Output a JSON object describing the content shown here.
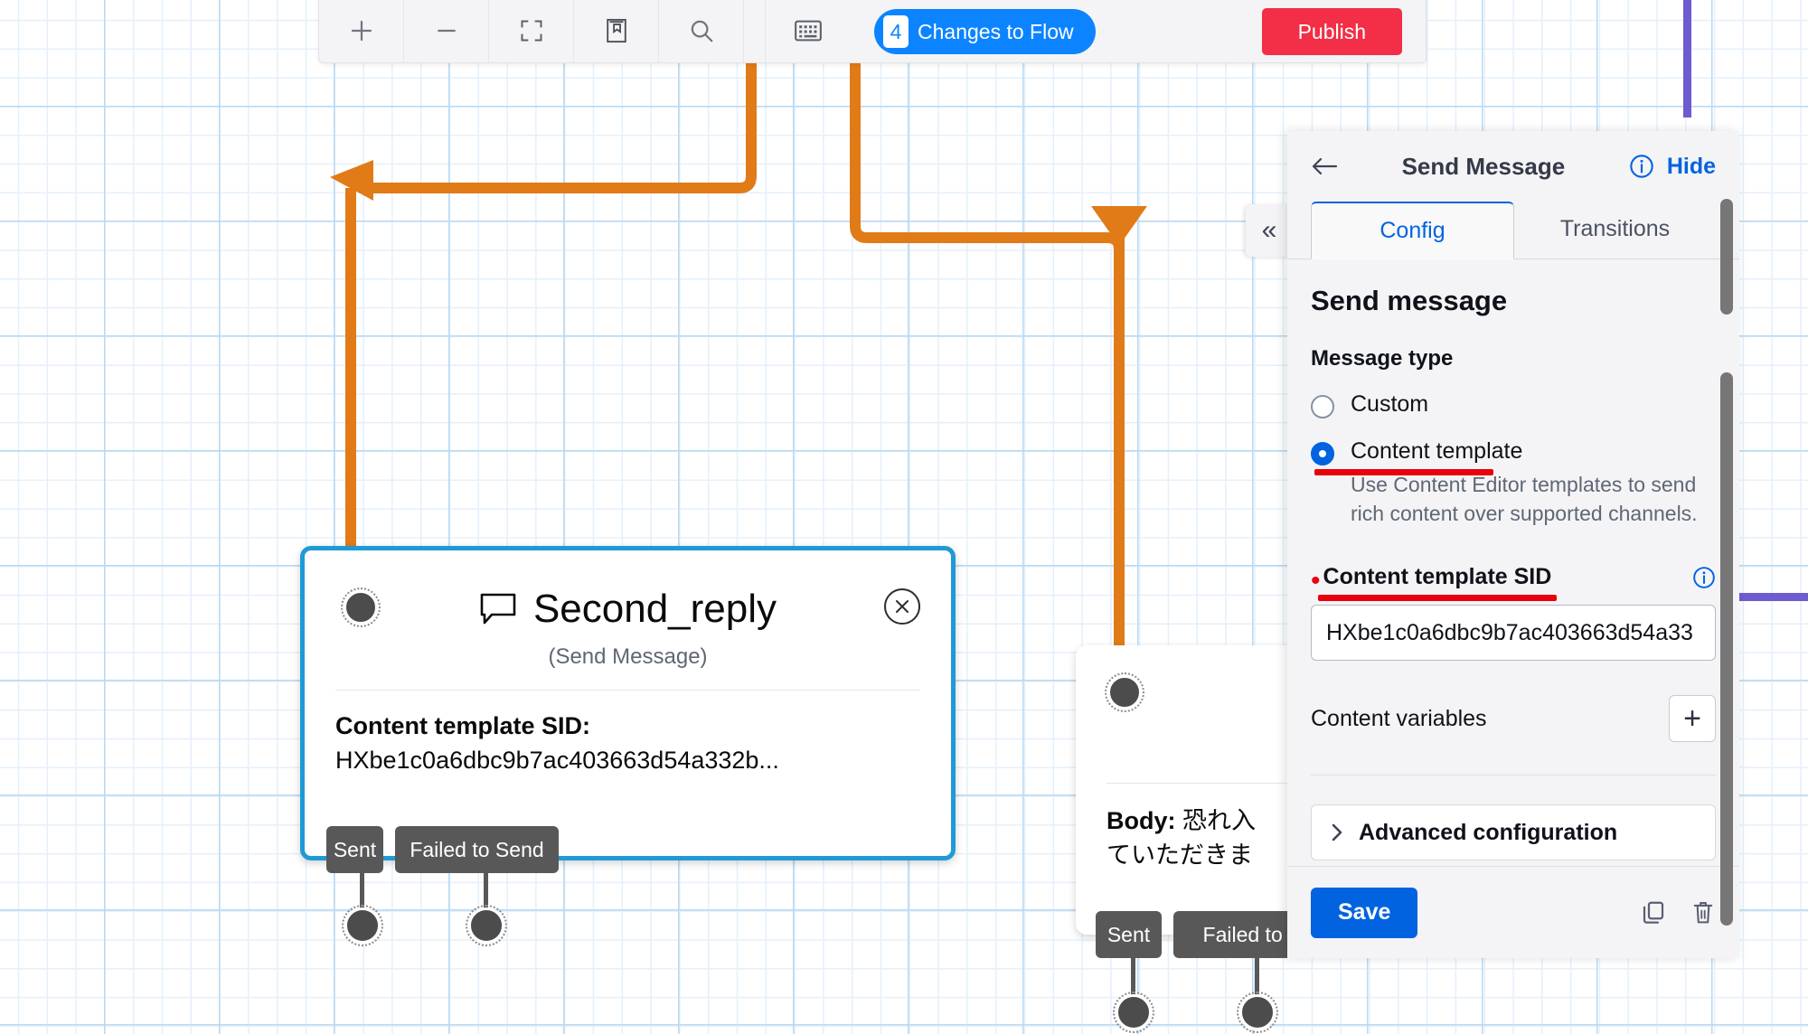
{
  "toolbar": {
    "buttons": [
      {
        "name": "zoom-in-icon",
        "label": "+"
      },
      {
        "name": "zoom-out-icon",
        "label": "−"
      },
      {
        "name": "fit-to-screen-icon",
        "label": ""
      },
      {
        "name": "library-icon",
        "label": ""
      },
      {
        "name": "search-icon",
        "label": ""
      },
      {
        "name": "keyboard-shortcuts-icon",
        "label": ""
      }
    ],
    "changes_count": "4",
    "changes_label": "Changes to Flow",
    "publish_label": "Publish",
    "accent_blue": "#0d84ff",
    "publish_red": "#f22f46"
  },
  "nodes": [
    {
      "id": "second-reply",
      "title": "Second_reply",
      "subtitle": "(Send Message)",
      "body_label": "Content template SID:",
      "body_value": "HXbe1c0a6dbc9b7ac403663d54a332b...",
      "selected": true,
      "outputs": [
        "Sent",
        "Failed to Send"
      ]
    },
    {
      "id": "third-node",
      "body_label": "Body:",
      "body_value": "恐れ入",
      "body_value_2": "ていただきま",
      "outputs": [
        "Sent",
        "Failed to S"
      ]
    }
  ],
  "panel": {
    "back_icon": "arrow-left-icon",
    "title": "Send Message",
    "info_icon": "info-circle-icon",
    "hide_label": "Hide",
    "tabs": [
      {
        "label": "Config",
        "active": true
      },
      {
        "label": "Transitions",
        "active": false
      }
    ],
    "section_title": "Send message",
    "message_type_label": "Message type",
    "options": [
      {
        "label": "Custom",
        "checked": false,
        "help": ""
      },
      {
        "label": "Content template",
        "checked": true,
        "help": "Use Content Editor templates to send rich content over supported channels."
      }
    ],
    "sid_label": "Content template SID",
    "sid_required": true,
    "sid_value": "HXbe1c0a6dbc9b7ac403663d54a33",
    "content_variables_label": "Content variables",
    "add_variable_label": "+",
    "advanced_label": "Advanced configuration",
    "advanced_chevron": "chevron-right-icon",
    "save_label": "Save",
    "duplicate_icon": "copy-icon",
    "delete_icon": "trash-icon",
    "accent_link": "#0263e0",
    "highlight_color": "#e8000d"
  },
  "collapse_panel_label": "«",
  "connector_color": "#e07b18",
  "purple_line_color": "#6d5bd0"
}
